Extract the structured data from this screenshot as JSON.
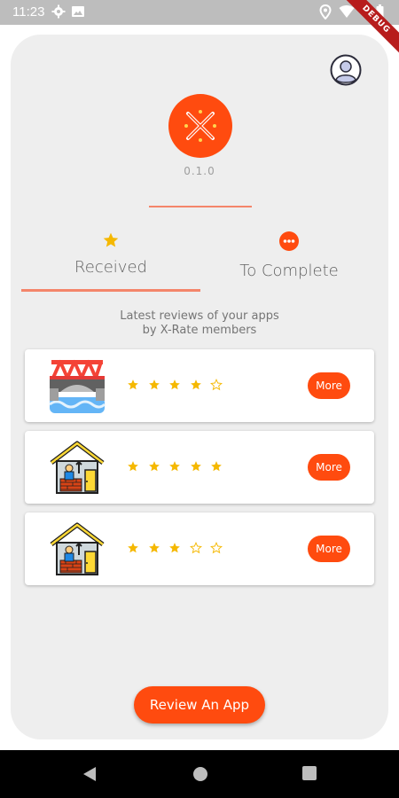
{
  "status_bar": {
    "time": "11:23",
    "left_icons": [
      "gear-icon",
      "image-icon"
    ],
    "right_icons": [
      "location-icon",
      "wifi-icon",
      "battery-icon"
    ],
    "ribbon": "DEBUG"
  },
  "header": {
    "avatar_icon": "user-icon",
    "logo_icon": "x-rate-logo",
    "version": "0.1.0"
  },
  "tabs": [
    {
      "label": "Received",
      "icon": "star-icon",
      "selected": true
    },
    {
      "label": "To Complete",
      "icon": "more-dots-icon",
      "selected": false
    }
  ],
  "subtitle_line1": "Latest reviews of your apps",
  "subtitle_line2": "by X-Rate members",
  "reviews": [
    {
      "app_icon": "bridge-icon",
      "rating": 4,
      "more_label": "More"
    },
    {
      "app_icon": "house-worker-icon",
      "rating": 5,
      "more_label": "More"
    },
    {
      "app_icon": "house-worker-icon",
      "rating": 3,
      "more_label": "More"
    }
  ],
  "review_app_label": "Review An App",
  "colors": {
    "accent": "#ff4b0f",
    "divider": "#f4856a",
    "star": "#f5b800",
    "background": "#eeeeee"
  },
  "nav_bar": {
    "icons": [
      "back-icon",
      "home-icon",
      "recents-icon"
    ]
  }
}
